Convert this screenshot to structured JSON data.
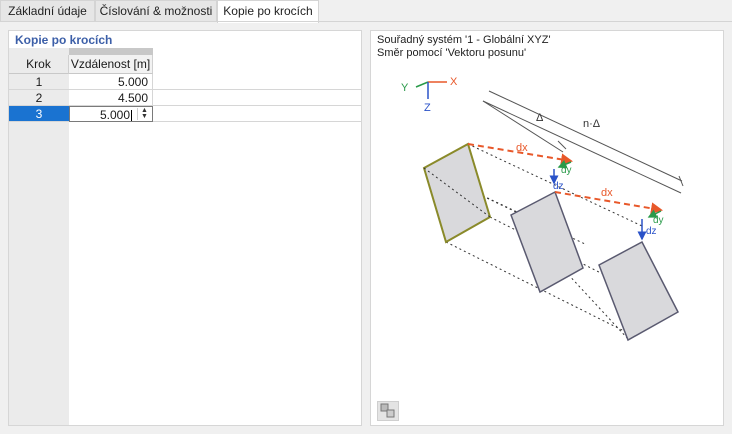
{
  "tabs": [
    {
      "label": "Základní údaje"
    },
    {
      "label": "Číslování & možnosti"
    },
    {
      "label": "Kopie po krocích"
    }
  ],
  "left": {
    "title": "Kopie po krocích",
    "table": {
      "col_krok": "Krok",
      "col_vzdalenost": "Vzdálenost [m]",
      "rows": [
        {
          "krok": "1",
          "value": "5.000"
        },
        {
          "krok": "2",
          "value": "4.500"
        },
        {
          "krok": "3",
          "value": "5.000"
        }
      ]
    }
  },
  "right": {
    "line1": "Souřadný systém '1 - Globální XYZ'",
    "line2": "Směr pomocí 'Vektoru posunu'",
    "axes": {
      "x": "X",
      "y": "Y",
      "z": "Z"
    },
    "labels": {
      "delta": "Δ",
      "n_delta": "n·Δ",
      "dx": "dx",
      "dy": "dy",
      "dz": "dz"
    }
  },
  "colors": {
    "accent": "#1a73d1",
    "title": "#3c5fa8",
    "dashed": "#e8582a",
    "olive": "#8a8a2a"
  }
}
